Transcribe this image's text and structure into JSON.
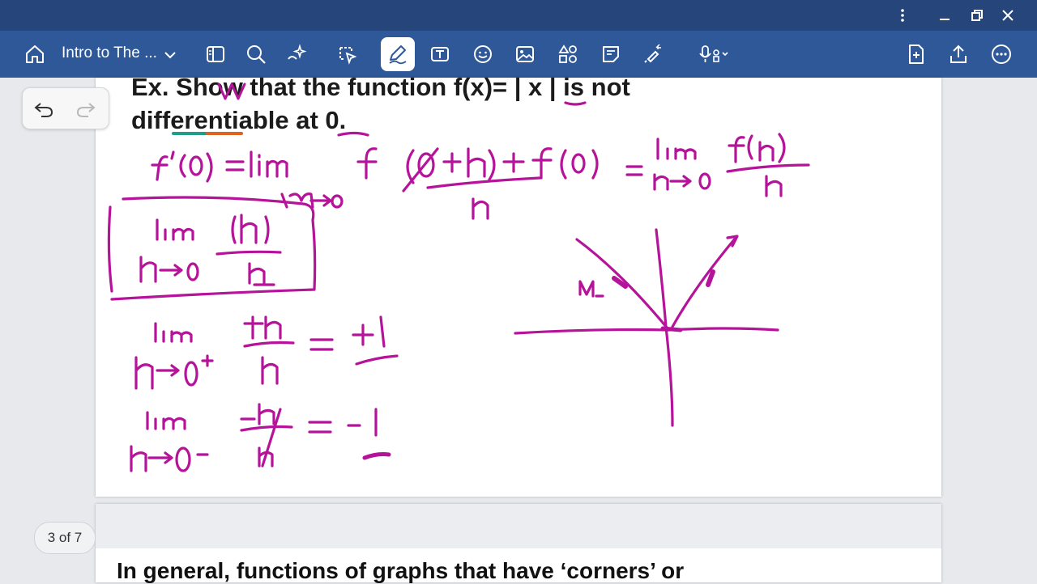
{
  "window": {
    "controls": [
      "more-vertical",
      "minimize",
      "restore",
      "close"
    ]
  },
  "toolbar": {
    "doc_title": "Intro to The ...",
    "tools": [
      "home-icon",
      "sidebar-icon",
      "search-icon",
      "ai-sparkle-icon",
      "lasso-icon",
      "pen-icon",
      "text-box-icon",
      "sticker-icon",
      "image-icon",
      "shapes-icon",
      "note-icon",
      "highlighter-icon",
      "audio-record-icon",
      "add-page-icon",
      "share-icon",
      "more-icon"
    ],
    "active_tool": "pen-icon",
    "accent_color": "#2f5899",
    "titlebar_color": "#26457a"
  },
  "page": {
    "line1": "Ex. Show that the function f(x)=  | x | is not",
    "line2": "differentiable at 0.",
    "ink_color": "#b5149a"
  },
  "next_page": {
    "text": "In general, functions of graphs that have ‘corners’ or"
  },
  "navigation": {
    "page_counter": "3 of 7"
  }
}
